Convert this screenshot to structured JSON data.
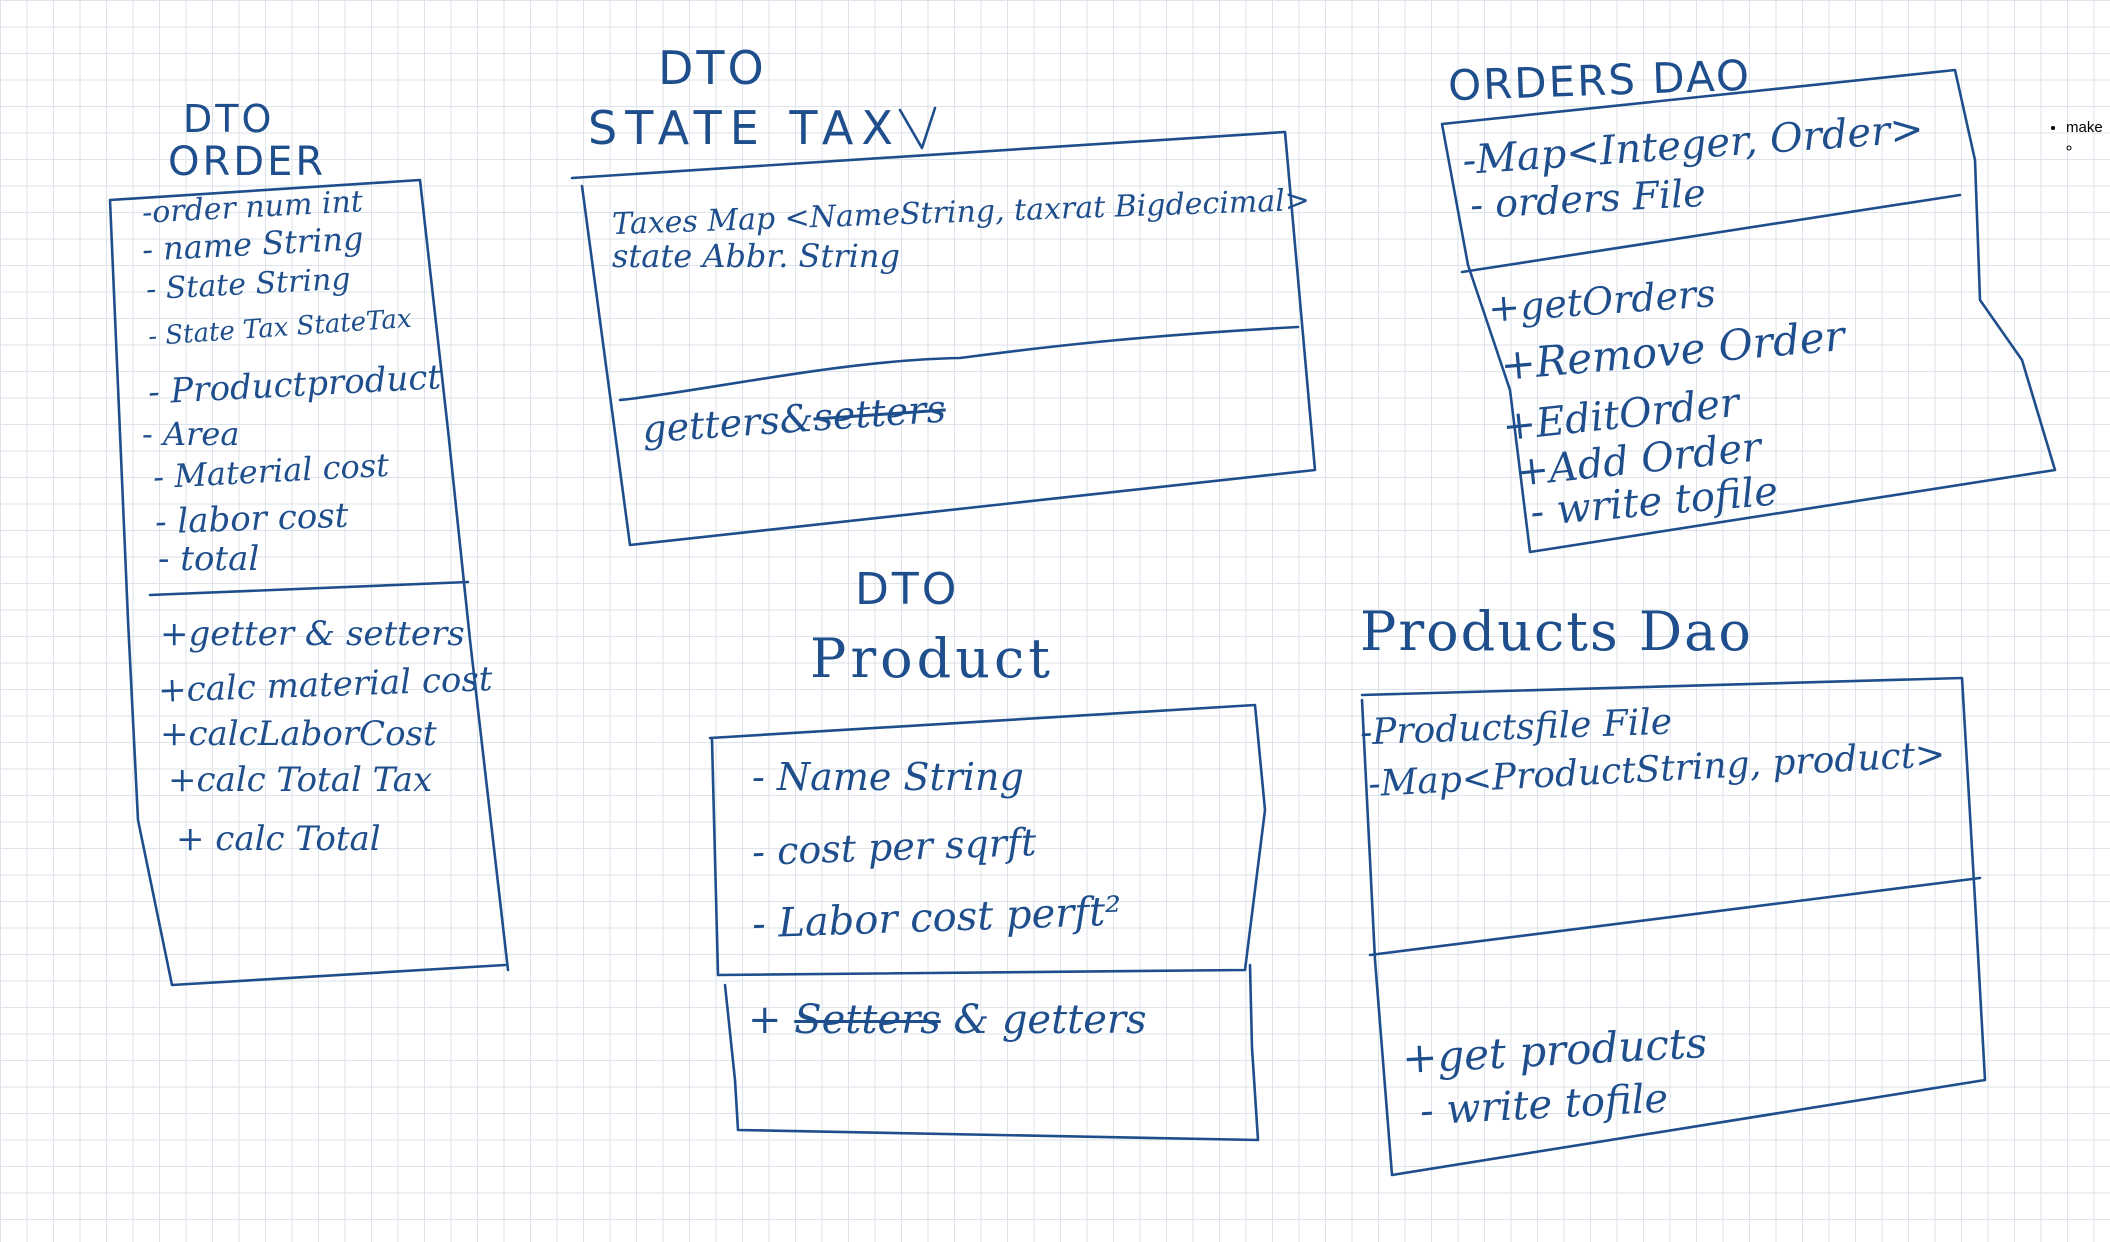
{
  "order_dto": {
    "title_1": "DTO",
    "title_2": "ORDER",
    "fields": [
      "-order num int",
      "- name String",
      "- State String",
      "- State Tax StateTax",
      "- Productproduct",
      "- Area",
      "- Material cost",
      "- labor cost",
      "- total"
    ],
    "methods": [
      "+getter & setters",
      "+calc material cost",
      "+calcLaborCost",
      "+calc Total Tax",
      "+ calc Total"
    ]
  },
  "state_tax_dto": {
    "title_1": "DTO",
    "title_2": "STATE TAX",
    "fields": [
      "Taxes Map <NameString, taxrat Bigdecimal>",
      "state Abbr. String"
    ],
    "methods_prefix": "getters&",
    "methods_struck": "setters"
  },
  "orders_dao": {
    "title": "ORDERS DAO",
    "fields": [
      "-Map<Integer, Order>",
      "- orders File"
    ],
    "methods": [
      "+getOrders",
      "+Remove Order",
      "+EditOrder",
      "+Add Order",
      "- write tofile"
    ]
  },
  "product_dto": {
    "title_1": "DTO",
    "title_2": "Product",
    "fields": [
      "- Name String",
      "- cost per sqrft",
      "- Labor cost perft²"
    ],
    "methods_prefix": "+",
    "methods_struck": "Setters",
    "methods_suffix": "& getters"
  },
  "products_dao": {
    "title": "Products Dao",
    "fields": [
      "-Productsfile File",
      "-Map<ProductString, product>"
    ],
    "methods": [
      "+get products",
      "- write tofile"
    ]
  },
  "sidebar_note": {
    "bullet": "make"
  }
}
